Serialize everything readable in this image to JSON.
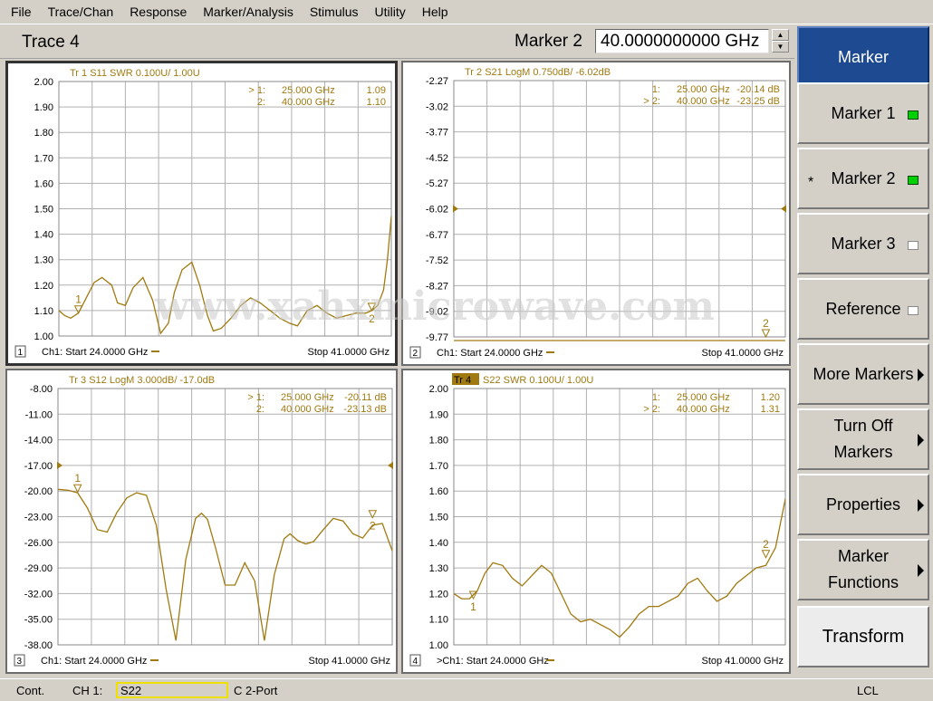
{
  "menu": [
    "File",
    "Trace/Chan",
    "Response",
    "Marker/Analysis",
    "Stimulus",
    "Utility",
    "Help"
  ],
  "header": {
    "trace_title": "Trace 4",
    "marker_label": "Marker 2",
    "marker_value": "40.0000000000 GHz"
  },
  "softkeys": [
    {
      "label": "Marker",
      "type": "title"
    },
    {
      "label": "Marker 1",
      "indicator": "on"
    },
    {
      "label": "Marker 2",
      "indicator": "on",
      "star": "*"
    },
    {
      "label": "Marker 3",
      "indicator": "off"
    },
    {
      "label": "Reference",
      "indicator": "off"
    },
    {
      "label": "More Markers",
      "arrow": true
    },
    {
      "label": "Turn Off\nMarkers",
      "arrow": true
    },
    {
      "label": "Properties",
      "arrow": true
    },
    {
      "label": "Marker\nFunctions",
      "arrow": true
    },
    {
      "label": "Transform",
      "type": "transform"
    }
  ],
  "status": {
    "mode": "Cont.",
    "channel": "CH 1:",
    "param": "S22",
    "cal": "C  2-Port",
    "lcl": "LCL"
  },
  "watermark": "www.xahxmicrowave.com",
  "colors": {
    "trace": "#a07a10",
    "grid": "#b0b0b0",
    "label": "#a07a10",
    "active_title_bg": "#1e4a92"
  },
  "chart_data": [
    {
      "type": "line",
      "panel": "1",
      "title": "Tr  1  S11 SWR 0.100U/  1.00U",
      "yticks": [
        "2.00",
        "1.90",
        "1.80",
        "1.70",
        "1.60",
        "1.50",
        "1.40",
        "1.30",
        "1.20",
        "1.10",
        "1.00"
      ],
      "ylim": [
        1.0,
        2.0
      ],
      "xlim": [
        24.0,
        41.0
      ],
      "footer_left": "Ch1: Start  24.0000 GHz",
      "footer_right": "Stop  41.0000 GHz",
      "markers_table": [
        {
          "flag": "> 1:",
          "freq": "25.000 GHz",
          "val": "1.09"
        },
        {
          "flag": "2:",
          "freq": "40.000 GHz",
          "val": "1.10"
        }
      ],
      "markers": [
        {
          "id": "1",
          "x": 25.0,
          "y": 1.09,
          "pos": "above"
        },
        {
          "id": "2",
          "x": 40.0,
          "y": 1.1,
          "pos": "below"
        }
      ],
      "ref_arrow": null,
      "x": [
        24.0,
        24.3,
        24.6,
        25.0,
        25.4,
        25.8,
        26.2,
        26.7,
        27.0,
        27.4,
        27.8,
        28.3,
        28.8,
        29.2,
        29.6,
        29.9,
        30.3,
        30.8,
        31.2,
        31.6,
        31.9,
        32.3,
        32.8,
        33.3,
        33.8,
        34.3,
        34.8,
        35.3,
        35.8,
        36.2,
        36.7,
        37.2,
        37.7,
        38.2,
        38.7,
        39.2,
        39.7,
        40.0,
        40.3,
        40.6,
        40.8,
        41.0
      ],
      "values": [
        1.1,
        1.08,
        1.07,
        1.09,
        1.15,
        1.21,
        1.23,
        1.2,
        1.13,
        1.12,
        1.19,
        1.23,
        1.14,
        1.01,
        1.05,
        1.17,
        1.26,
        1.29,
        1.2,
        1.08,
        1.02,
        1.03,
        1.07,
        1.12,
        1.15,
        1.13,
        1.1,
        1.07,
        1.05,
        1.04,
        1.1,
        1.12,
        1.09,
        1.07,
        1.08,
        1.09,
        1.09,
        1.1,
        1.12,
        1.18,
        1.3,
        1.47
      ]
    },
    {
      "type": "line",
      "panel": "2",
      "title": "Tr  2  S21 LogM 0.750dB/  -6.02dB",
      "yticks": [
        "-2.27",
        "-3.02",
        "-3.77",
        "-4.52",
        "-5.27",
        "-6.02",
        "-6.77",
        "-7.52",
        "-8.27",
        "-9.02",
        "-9.77"
      ],
      "ylim": [
        -9.77,
        -2.27
      ],
      "xlim": [
        24.0,
        41.0
      ],
      "footer_left": "Ch1: Start  24.0000 GHz",
      "footer_right": "Stop  41.0000 GHz",
      "markers_table": [
        {
          "flag": "1:",
          "freq": "25.000 GHz",
          "val": "-20.14 dB"
        },
        {
          "flag": "> 2:",
          "freq": "40.000 GHz",
          "val": "-23.25 dB"
        }
      ],
      "markers": [
        {
          "id": "2",
          "x": 40.0,
          "y": -9.77,
          "pos": "above"
        }
      ],
      "ref_arrow": -6.02,
      "x": [
        24.0,
        41.0
      ],
      "values": [
        -9.9,
        -9.9
      ]
    },
    {
      "type": "line",
      "panel": "3",
      "title": "Tr  3  S12 LogM 3.000dB/  -17.0dB",
      "yticks": [
        "-8.00",
        "-11.00",
        "-14.00",
        "-17.00",
        "-20.00",
        "-23.00",
        "-26.00",
        "-29.00",
        "-32.00",
        "-35.00",
        "-38.00"
      ],
      "ylim": [
        -38.0,
        -8.0
      ],
      "xlim": [
        24.0,
        41.0
      ],
      "footer_left": "Ch1: Start  24.0000 GHz",
      "footer_right": "Stop  41.0000 GHz",
      "markers_table": [
        {
          "flag": "> 1:",
          "freq": "25.000 GHz",
          "val": "-20.11 dB"
        },
        {
          "flag": "2:",
          "freq": "40.000 GHz",
          "val": "-23.13 dB"
        }
      ],
      "markers": [
        {
          "id": "1",
          "x": 25.0,
          "y": -20.11,
          "pos": "above"
        },
        {
          "id": "2",
          "x": 40.0,
          "y": -23.13,
          "pos": "below"
        }
      ],
      "ref_arrow": -17.0,
      "x": [
        24.0,
        24.5,
        25.0,
        25.5,
        26.0,
        26.5,
        27.0,
        27.5,
        28.0,
        28.5,
        29.0,
        29.5,
        30.0,
        30.5,
        31.0,
        31.3,
        31.6,
        32.0,
        32.5,
        33.0,
        33.5,
        34.0,
        34.5,
        35.0,
        35.5,
        35.8,
        36.2,
        36.6,
        37.0,
        37.5,
        38.0,
        38.5,
        39.0,
        39.5,
        40.0,
        40.5,
        41.0
      ],
      "values": [
        -19.8,
        -19.9,
        -20.2,
        -22.0,
        -24.5,
        -24.8,
        -22.5,
        -20.8,
        -20.2,
        -20.5,
        -24.0,
        -31.5,
        -37.5,
        -28.0,
        -23.2,
        -22.6,
        -23.3,
        -26.5,
        -31.0,
        -31.0,
        -28.4,
        -30.5,
        -37.5,
        -29.8,
        -25.6,
        -25.0,
        -25.8,
        -26.2,
        -25.9,
        -24.5,
        -23.2,
        -23.5,
        -25.0,
        -25.5,
        -24.0,
        -23.8,
        -27.0
      ]
    },
    {
      "type": "line",
      "panel": "4",
      "title": "S22 SWR 0.100U/  1.00U",
      "title_tag": "Tr  4",
      "yticks": [
        "2.00",
        "1.90",
        "1.80",
        "1.70",
        "1.60",
        "1.50",
        "1.40",
        "1.30",
        "1.20",
        "1.10",
        "1.00"
      ],
      "ylim": [
        1.0,
        2.0
      ],
      "xlim": [
        24.0,
        41.0
      ],
      "footer_left": ">Ch1: Start  24.0000 GHz",
      "footer_right": "Stop  41.0000 GHz",
      "markers_table": [
        {
          "flag": "1:",
          "freq": "25.000 GHz",
          "val": "1.20"
        },
        {
          "flag": "> 2:",
          "freq": "40.000 GHz",
          "val": "1.31"
        }
      ],
      "markers": [
        {
          "id": "1",
          "x": 25.0,
          "y": 1.18,
          "pos": "below"
        },
        {
          "id": "2",
          "x": 40.0,
          "y": 1.34,
          "pos": "above"
        }
      ],
      "ref_arrow": null,
      "x": [
        24.0,
        24.4,
        24.8,
        25.2,
        25.6,
        26.0,
        26.5,
        27.0,
        27.5,
        28.0,
        28.5,
        29.0,
        29.5,
        30.0,
        30.5,
        31.0,
        31.5,
        32.0,
        32.5,
        33.0,
        33.5,
        34.0,
        34.5,
        35.0,
        35.5,
        36.0,
        36.5,
        37.0,
        37.5,
        38.0,
        38.5,
        39.0,
        39.5,
        40.0,
        40.5,
        41.0
      ],
      "values": [
        1.2,
        1.18,
        1.18,
        1.21,
        1.28,
        1.32,
        1.31,
        1.26,
        1.23,
        1.27,
        1.31,
        1.28,
        1.2,
        1.12,
        1.09,
        1.1,
        1.08,
        1.06,
        1.03,
        1.07,
        1.12,
        1.15,
        1.15,
        1.17,
        1.19,
        1.24,
        1.26,
        1.21,
        1.17,
        1.19,
        1.24,
        1.27,
        1.3,
        1.31,
        1.38,
        1.57
      ]
    }
  ]
}
